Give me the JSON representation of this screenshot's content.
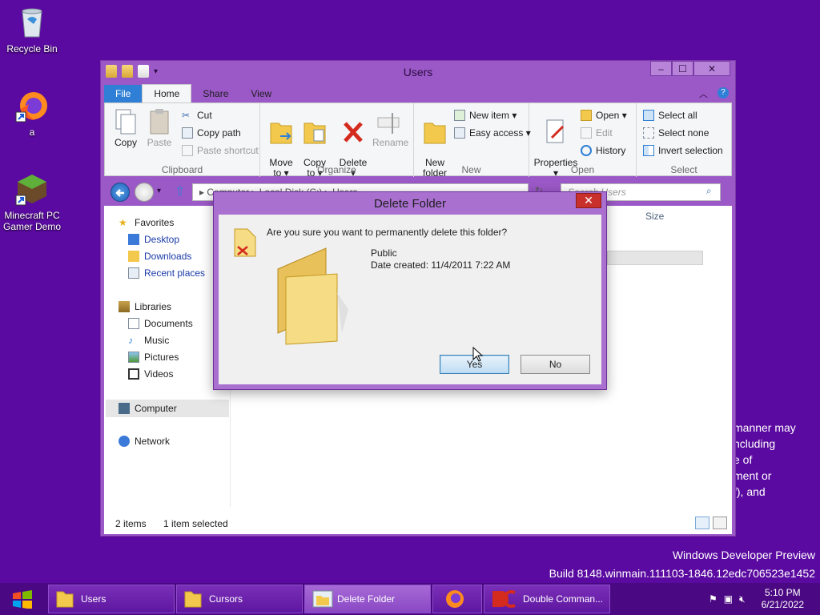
{
  "desktop": {
    "icons": [
      {
        "label": "Recycle Bin"
      },
      {
        "label": "a"
      },
      {
        "label": "Minecraft PC\nGamer Demo"
      }
    ],
    "watermark_line1": "Windows Developer Preview",
    "watermark_line2": "Build 8148.winmain.111103-1846.12edc706523e1452",
    "eula_fragment": "manner may\nncluding\ne of\nment or\nf), and"
  },
  "window": {
    "title": "Users",
    "tabs": {
      "file": "File",
      "home": "Home",
      "share": "Share",
      "view": "View"
    },
    "ribbon": {
      "clipboard": {
        "label": "Clipboard",
        "copy": "Copy",
        "paste": "Paste",
        "cut": "Cut",
        "copy_path": "Copy path",
        "paste_shortcut": "Paste shortcut"
      },
      "organize": {
        "label": "Organize",
        "move_to": "Move\nto ▾",
        "copy_to": "Copy\nto ▾",
        "delete": "Delete\n▾",
        "rename": "Rename"
      },
      "new": {
        "label": "New",
        "new_folder": "New\nfolder",
        "new_item": "New item ▾",
        "easy_access": "Easy access ▾"
      },
      "open": {
        "label": "Open",
        "properties": "Properties\n▾",
        "open": "Open ▾",
        "edit": "Edit",
        "history": "History"
      },
      "select": {
        "label": "Select",
        "select_all": "Select all",
        "select_none": "Select none",
        "invert_selection": "Invert selection"
      }
    },
    "address": "▸  Computer  ▸  Local Disk (C:)  ▸  Users",
    "search_placeholder": "Search Users",
    "nav": {
      "favorites": "Favorites",
      "desktop": "Desktop",
      "downloads": "Downloads",
      "recent_places": "Recent places",
      "libraries": "Libraries",
      "documents": "Documents",
      "music": "Music",
      "pictures": "Pictures",
      "videos": "Videos",
      "computer": "Computer",
      "network": "Network"
    },
    "column_size": "Size",
    "status": {
      "items": "2 items",
      "selected": "1 item selected"
    }
  },
  "dialog": {
    "title": "Delete Folder",
    "question": "Are you sure you want to permanently delete this folder?",
    "folder_name": "Public",
    "date_created": "Date created: 11/4/2011 7:22 AM",
    "yes": "Yes",
    "no": "No"
  },
  "taskbar": {
    "tasks": [
      {
        "label": "Users"
      },
      {
        "label": "Cursors"
      },
      {
        "label": "Delete Folder"
      },
      {
        "label": ""
      },
      {
        "label": "Double Comman..."
      }
    ],
    "time": "5:10 PM",
    "date": "6/21/2022"
  },
  "colors": {
    "desktop": "#5a0aa0",
    "window_frame": "#9b59c7",
    "file_tab": "#2f7fd6",
    "close_red": "#c9302c"
  }
}
